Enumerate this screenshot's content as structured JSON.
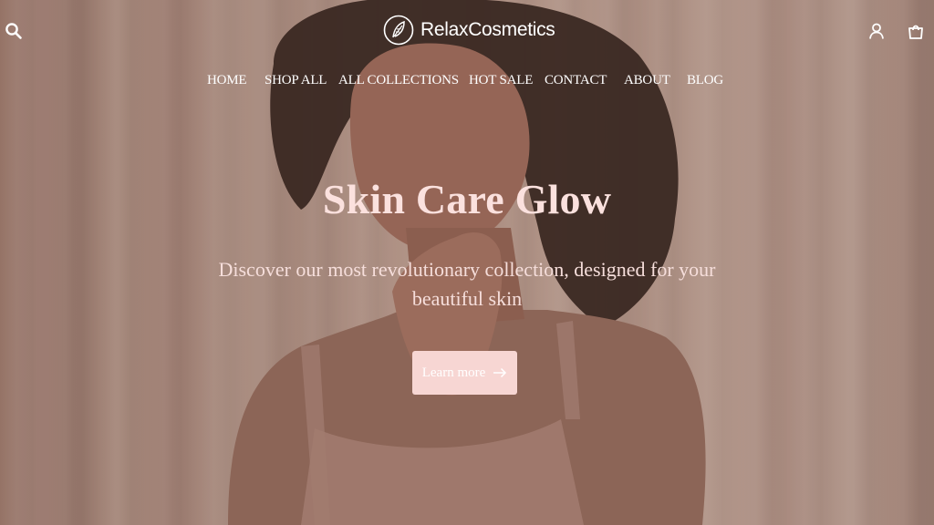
{
  "header": {
    "brand": "RelaxCosmetics",
    "icons": {
      "search": "search-icon",
      "account": "user-icon",
      "cart": "shopping-bag-icon",
      "logo": "leaf-logo-icon"
    }
  },
  "nav": {
    "items": [
      {
        "label": "HOME"
      },
      {
        "label": "SHOP ALL"
      },
      {
        "label": "ALL COLLECTIONS"
      },
      {
        "label": "HOT SALE"
      },
      {
        "label": "CONTACT"
      },
      {
        "label": "ABOUT"
      },
      {
        "label": "BLOG"
      }
    ]
  },
  "hero": {
    "title": "Skin Care Glow",
    "subtitle": "Discover our most revolutionary collection, designed for your beautiful skin",
    "cta_label": "Learn more",
    "cta_icon": "arrow-right-icon"
  },
  "colors": {
    "title": "#fbe1de",
    "button_bg": "#f7d6d3",
    "text_light": "#ffffff"
  }
}
